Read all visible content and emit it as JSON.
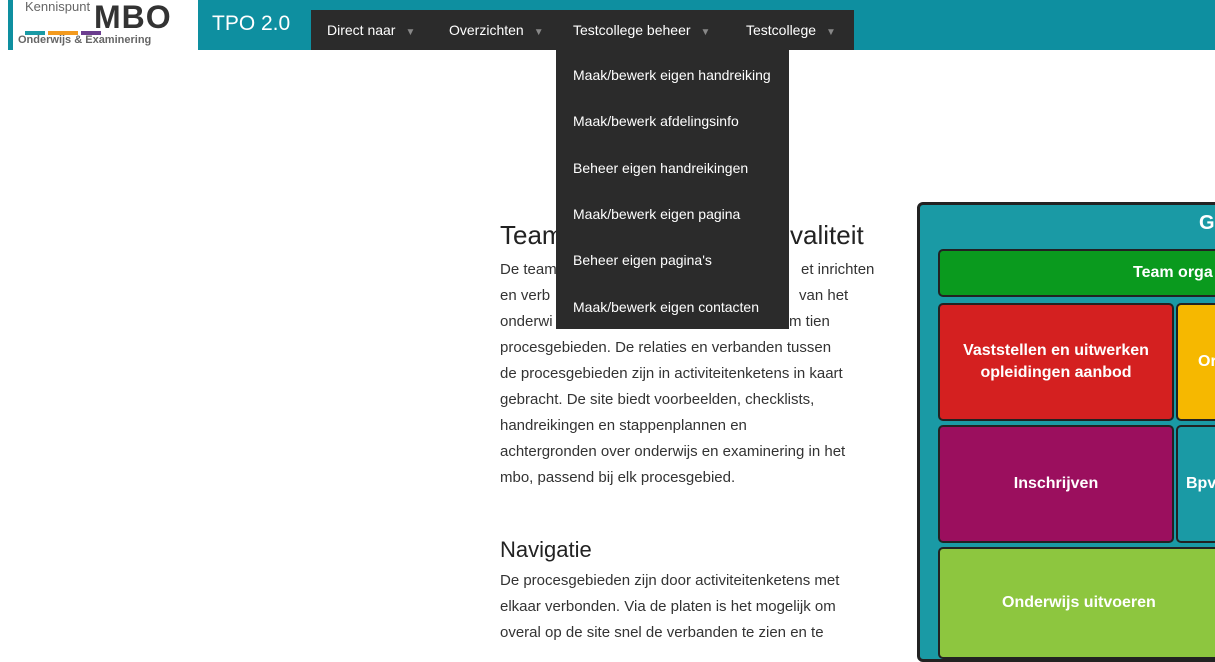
{
  "logo": {
    "kennispunt": "Kennispunt",
    "mbo": "MBO",
    "subtitle": "Onderwijs & Examinering",
    "bar_colors": [
      "#1a9aa5",
      "#f39a1e",
      "#6b3d8f"
    ]
  },
  "brand": {
    "title": "TPO 2.0"
  },
  "nav": {
    "items": [
      {
        "label": "Direct naar"
      },
      {
        "label": "Overzichten"
      },
      {
        "label": "Testcollege beheer"
      },
      {
        "label": "Testcollege"
      }
    ],
    "caret": "▼"
  },
  "dropdown": {
    "items": [
      {
        "label": "Maak/bewerk eigen handreiking"
      },
      {
        "label": "Maak/bewerk afdelingsinfo"
      },
      {
        "label": "Beheer eigen handreikingen"
      },
      {
        "label": "Maak/bewerk eigen pagina"
      },
      {
        "label": "Beheer eigen pagina's"
      },
      {
        "label": "Maak/bewerk eigen contacten"
      }
    ]
  },
  "main": {
    "heading_visible_left": "Team",
    "heading_visible_right": "valiteit",
    "para1_fragments": [
      "De team",
      "et inrichten",
      "en verb",
      "van het",
      "onderwi",
      "m tien"
    ],
    "para1_lines": [
      "procesgebieden. De relaties en verbanden tussen",
      "de procesgebieden zijn in activiteitenketens in kaart",
      "gebracht. De site biedt voorbeelden, checklists,",
      "handreikingen en stappenplannen en",
      "achtergronden over onderwijs en examinering in het",
      "mbo, passend bij elk procesgebied."
    ],
    "nav_heading": "Navigatie",
    "para2_lines": [
      "De procesgebieden zijn door activiteitenketens met",
      "elkaar verbonden. Via de platen is het mogelijk om",
      "overal op de site snel de verbanden te zien en te"
    ]
  },
  "diagram": {
    "title_fragment": "G",
    "blocks": [
      {
        "label": "Team orga",
        "color": "#0a9a1e"
      },
      {
        "label": "Vaststellen en uitwerken opleidingen aanbod",
        "color": "#d42020"
      },
      {
        "label": "Or",
        "color": "#f6b800"
      },
      {
        "label": "Inschrijven",
        "color": "#9b0f5e"
      },
      {
        "label": "Bpv",
        "color": "#1a9aa5"
      },
      {
        "label": "Onderwijs uitvoeren",
        "color": "#8dc63f"
      }
    ]
  }
}
